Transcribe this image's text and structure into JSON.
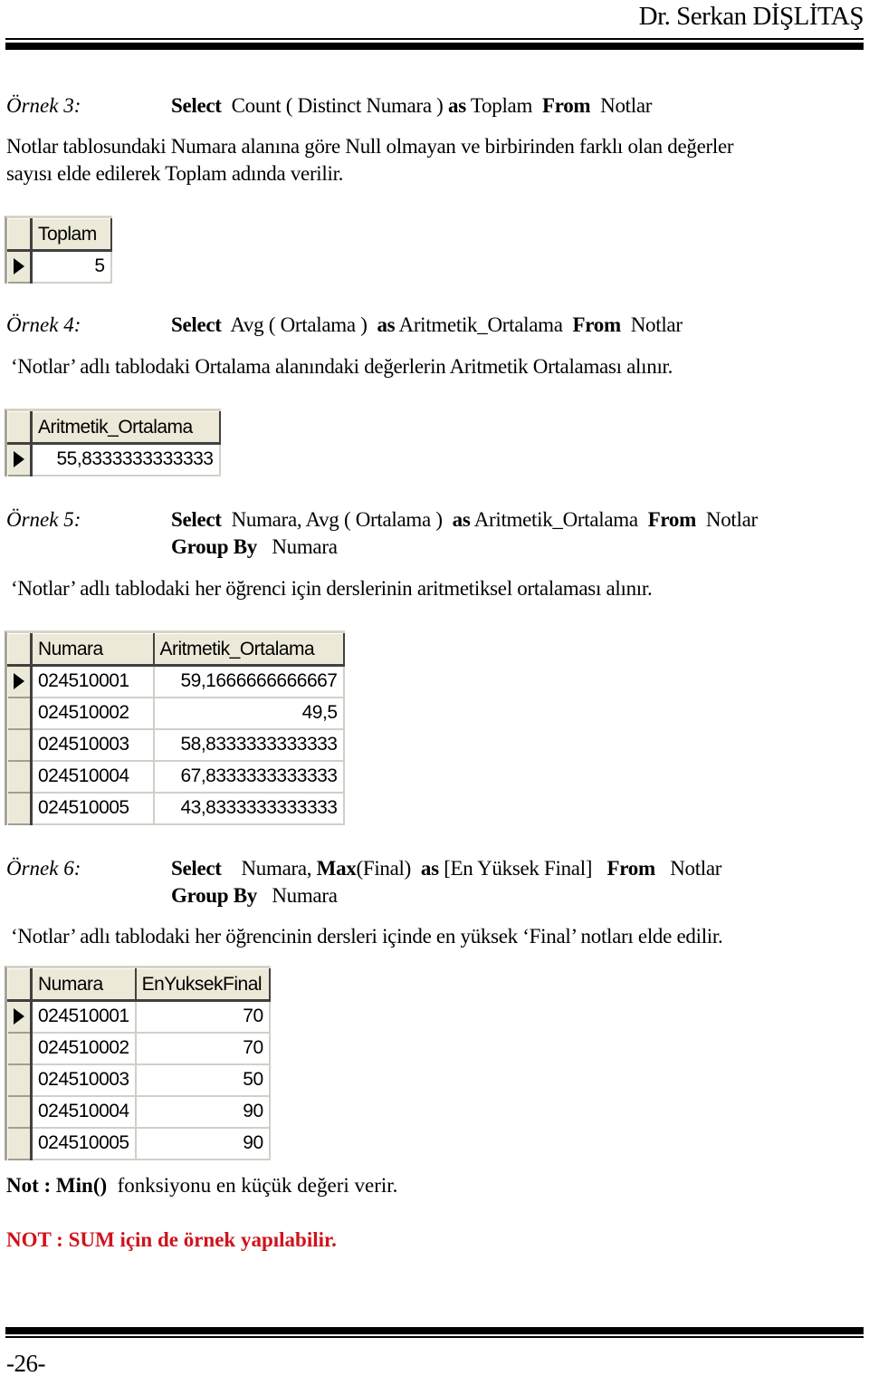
{
  "header": {
    "author": "Dr. Serkan DİŞLİTAŞ"
  },
  "examples": [
    {
      "label": "Örnek 3:",
      "sql": {
        "kw1": "Select",
        "t1": "Count ( Distinct Numara )",
        "kw2": "as",
        "t2": "Toplam",
        "kw3": "From",
        "t3": "Notlar"
      },
      "description_lines": [
        "Notlar tablosundaki Numara alanına göre Null olmayan ve birbirinden farklı olan değerler",
        "sayısı elde edilerek Toplam adında verilir."
      ],
      "grid": {
        "columns": [
          "Toplam"
        ],
        "rows": [
          [
            "5"
          ]
        ]
      }
    },
    {
      "label": "Örnek 4:",
      "sql": {
        "kw1": "Select",
        "t1": "Avg ( Ortalama )",
        "kw2": "as",
        "t2": "Aritmetik_Ortalama",
        "kw3": "From",
        "t3": "Notlar"
      },
      "description_lines": [
        "‘Notlar’ adlı tablodaki Ortalama alanındaki değerlerin Aritmetik Ortalaması alınır."
      ],
      "grid": {
        "columns": [
          "Aritmetik_Ortalama"
        ],
        "rows": [
          [
            "55,8333333333333"
          ]
        ]
      }
    },
    {
      "label": "Örnek 5:",
      "sql": {
        "kw1": "Select",
        "t1": "Numara, Avg ( Ortalama )",
        "kw2": "as",
        "t2": "Aritmetik_Ortalama",
        "kw3": "From",
        "t3": "Notlar",
        "kw4": "Group By",
        "t4": "Numara"
      },
      "description_lines": [
        "‘Notlar’ adlı tablodaki her öğrenci için derslerinin aritmetiksel  ortalaması alınır."
      ],
      "grid": {
        "columns": [
          "Numara",
          "Aritmetik_Ortalama"
        ],
        "rows": [
          [
            "024510001",
            "59,1666666666667"
          ],
          [
            "024510002",
            "49,5"
          ],
          [
            "024510003",
            "58,8333333333333"
          ],
          [
            "024510004",
            "67,8333333333333"
          ],
          [
            "024510005",
            "43,8333333333333"
          ]
        ]
      }
    },
    {
      "label": "Örnek 6:",
      "sql": {
        "kw1": "Select",
        "t1": "Numara,",
        "kw1b": "Max",
        "t1b": "(Final)",
        "kw2": "as",
        "t2": "[En Yüksek Final]",
        "kw3": "From",
        "t3": "Notlar",
        "kw4": "Group By",
        "t4": "Numara"
      },
      "description_lines": [
        "‘Notlar’ adlı tablodaki her öğrencinin dersleri içinde en yüksek ‘Final’ notları elde edilir."
      ],
      "grid": {
        "columns": [
          "Numara",
          "EnYuksekFinal"
        ],
        "rows": [
          [
            "024510001",
            "70"
          ],
          [
            "024510002",
            "70"
          ],
          [
            "024510003",
            "50"
          ],
          [
            "024510004",
            "90"
          ],
          [
            "024510005",
            "90"
          ]
        ]
      }
    }
  ],
  "notes": {
    "min": {
      "kw": "Not : Min()",
      "text": "fonksiyonu en küçük değeri verir."
    },
    "sum": {
      "text": "NOT : SUM için de örnek yapılabilir.",
      "color": "#d0121b"
    }
  },
  "footer": {
    "page_number": "-26-"
  }
}
